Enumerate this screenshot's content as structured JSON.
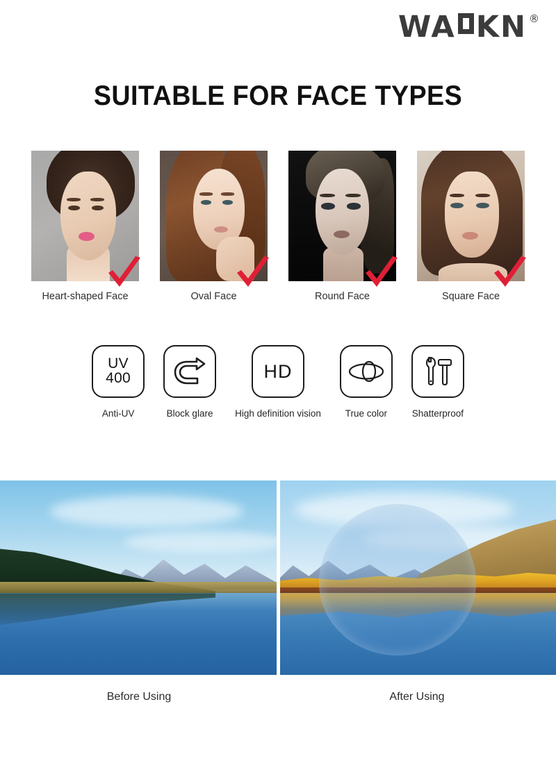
{
  "brand": {
    "name": "WAOKN",
    "letters_before_square": "WA",
    "square_letter": "O",
    "letters_after_square": "KN",
    "trademark": "®",
    "color": "#3b3b3b"
  },
  "headline": {
    "title": "SUITABLE FOR FACE TYPES",
    "color": "#111111"
  },
  "face_types": {
    "check_color": "#e01f36",
    "items": [
      {
        "label": "Heart-shaped Face",
        "photo_name": "heart-shaped-face-photo",
        "checked": true
      },
      {
        "label": "Oval Face",
        "photo_name": "oval-face-photo",
        "checked": true
      },
      {
        "label": "Round Face",
        "photo_name": "round-face-photo",
        "checked": true
      },
      {
        "label": "Square Face",
        "photo_name": "square-face-photo",
        "checked": true
      }
    ]
  },
  "features": [
    {
      "label": "Anti-UV",
      "icon": "uv400-icon",
      "text_line1": "UV",
      "text_line2": "400"
    },
    {
      "label": "Block glare",
      "icon": "u-turn-arrow-icon"
    },
    {
      "label": "High definition vision",
      "icon": "hd-icon",
      "text": "HD"
    },
    {
      "label": "True color",
      "icon": "overlapping-ellipses-icon"
    },
    {
      "label": "Shatterproof",
      "icon": "wrench-hammer-icon"
    }
  ],
  "comparison": {
    "before": {
      "label": "Before Using",
      "scene": "lake-mountain-landscape-washed"
    },
    "after": {
      "label": "After Using",
      "scene": "lake-mountain-landscape-vivid",
      "lens_overlay": true
    }
  }
}
